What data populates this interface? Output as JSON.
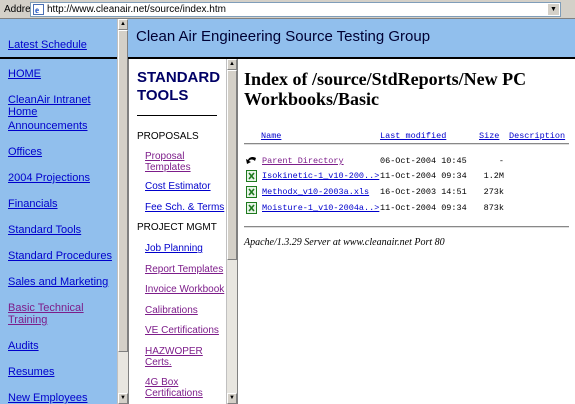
{
  "address_bar": {
    "label": "Address",
    "url": "http://www.cleanair.net/source/index.htm"
  },
  "header": {
    "title": "Clean Air Engineering Source Testing Group"
  },
  "left_frame": {
    "top_link": "Latest Schedule",
    "nav": [
      {
        "label": "HOME",
        "visited": false
      },
      {
        "label": "CleanAir Intranet Home",
        "visited": false
      },
      {
        "label": "Announcements",
        "visited": false
      },
      {
        "label": "Offices",
        "visited": false
      },
      {
        "label": "2004 Projections",
        "visited": false
      },
      {
        "label": "Financials",
        "visited": false
      },
      {
        "label": "Standard Tools",
        "visited": false
      },
      {
        "label": "Standard Procedures",
        "visited": false
      },
      {
        "label": "Sales and Marketing",
        "visited": false
      },
      {
        "label": "Basic Technical Training",
        "visited": true
      },
      {
        "label": "Audits",
        "visited": false
      },
      {
        "label": "Resumes",
        "visited": false
      },
      {
        "label": "New Employees",
        "visited": false
      }
    ]
  },
  "mid_frame": {
    "title": "STANDARD TOOLS",
    "sections": {
      "proposals": "PROPOSALS",
      "project_mgmt": "PROJECT MGMT"
    },
    "links": {
      "proposal_templates": "Proposal Templates",
      "cost_estimator": "Cost Estimator",
      "fee_schedule": "Fee Sch. & Terms",
      "job_planning": "Job Planning",
      "report_templates": "Report Templates",
      "invoice_workbook": "Invoice Workbook",
      "calibrations": "Calibrations",
      "ve_certifications": "VE Certifications",
      "hazwoper": "HAZWOPER Certs.",
      "four_g_box": "4G Box Certifications"
    }
  },
  "main_frame": {
    "heading": "Index of /source/StdReports/New PC Workbooks/Basic",
    "columns": {
      "name": "Name",
      "last_modified": "Last modified",
      "size": "Size",
      "description": "Description"
    },
    "rows": [
      {
        "icon": "back-arrow-icon",
        "name": "Parent Directory",
        "modified": "06-Oct-2004 10:45",
        "size": "-"
      },
      {
        "icon": "excel-file-icon",
        "name": "Isokinetic-1_v10-200..>",
        "modified": "11-Oct-2004 09:34",
        "size": "1.2M"
      },
      {
        "icon": "excel-file-icon",
        "name": "Methodx_v10-2003a.xls",
        "modified": "16-Oct-2003 14:51",
        "size": "273k"
      },
      {
        "icon": "excel-file-icon",
        "name": "Moisture-1_v10-2004a..>",
        "modified": "11-Oct-2004 09:34",
        "size": "873k"
      }
    ],
    "server_signature": "Apache/1.3.29 Server at www.cleanair.net Port 80"
  }
}
